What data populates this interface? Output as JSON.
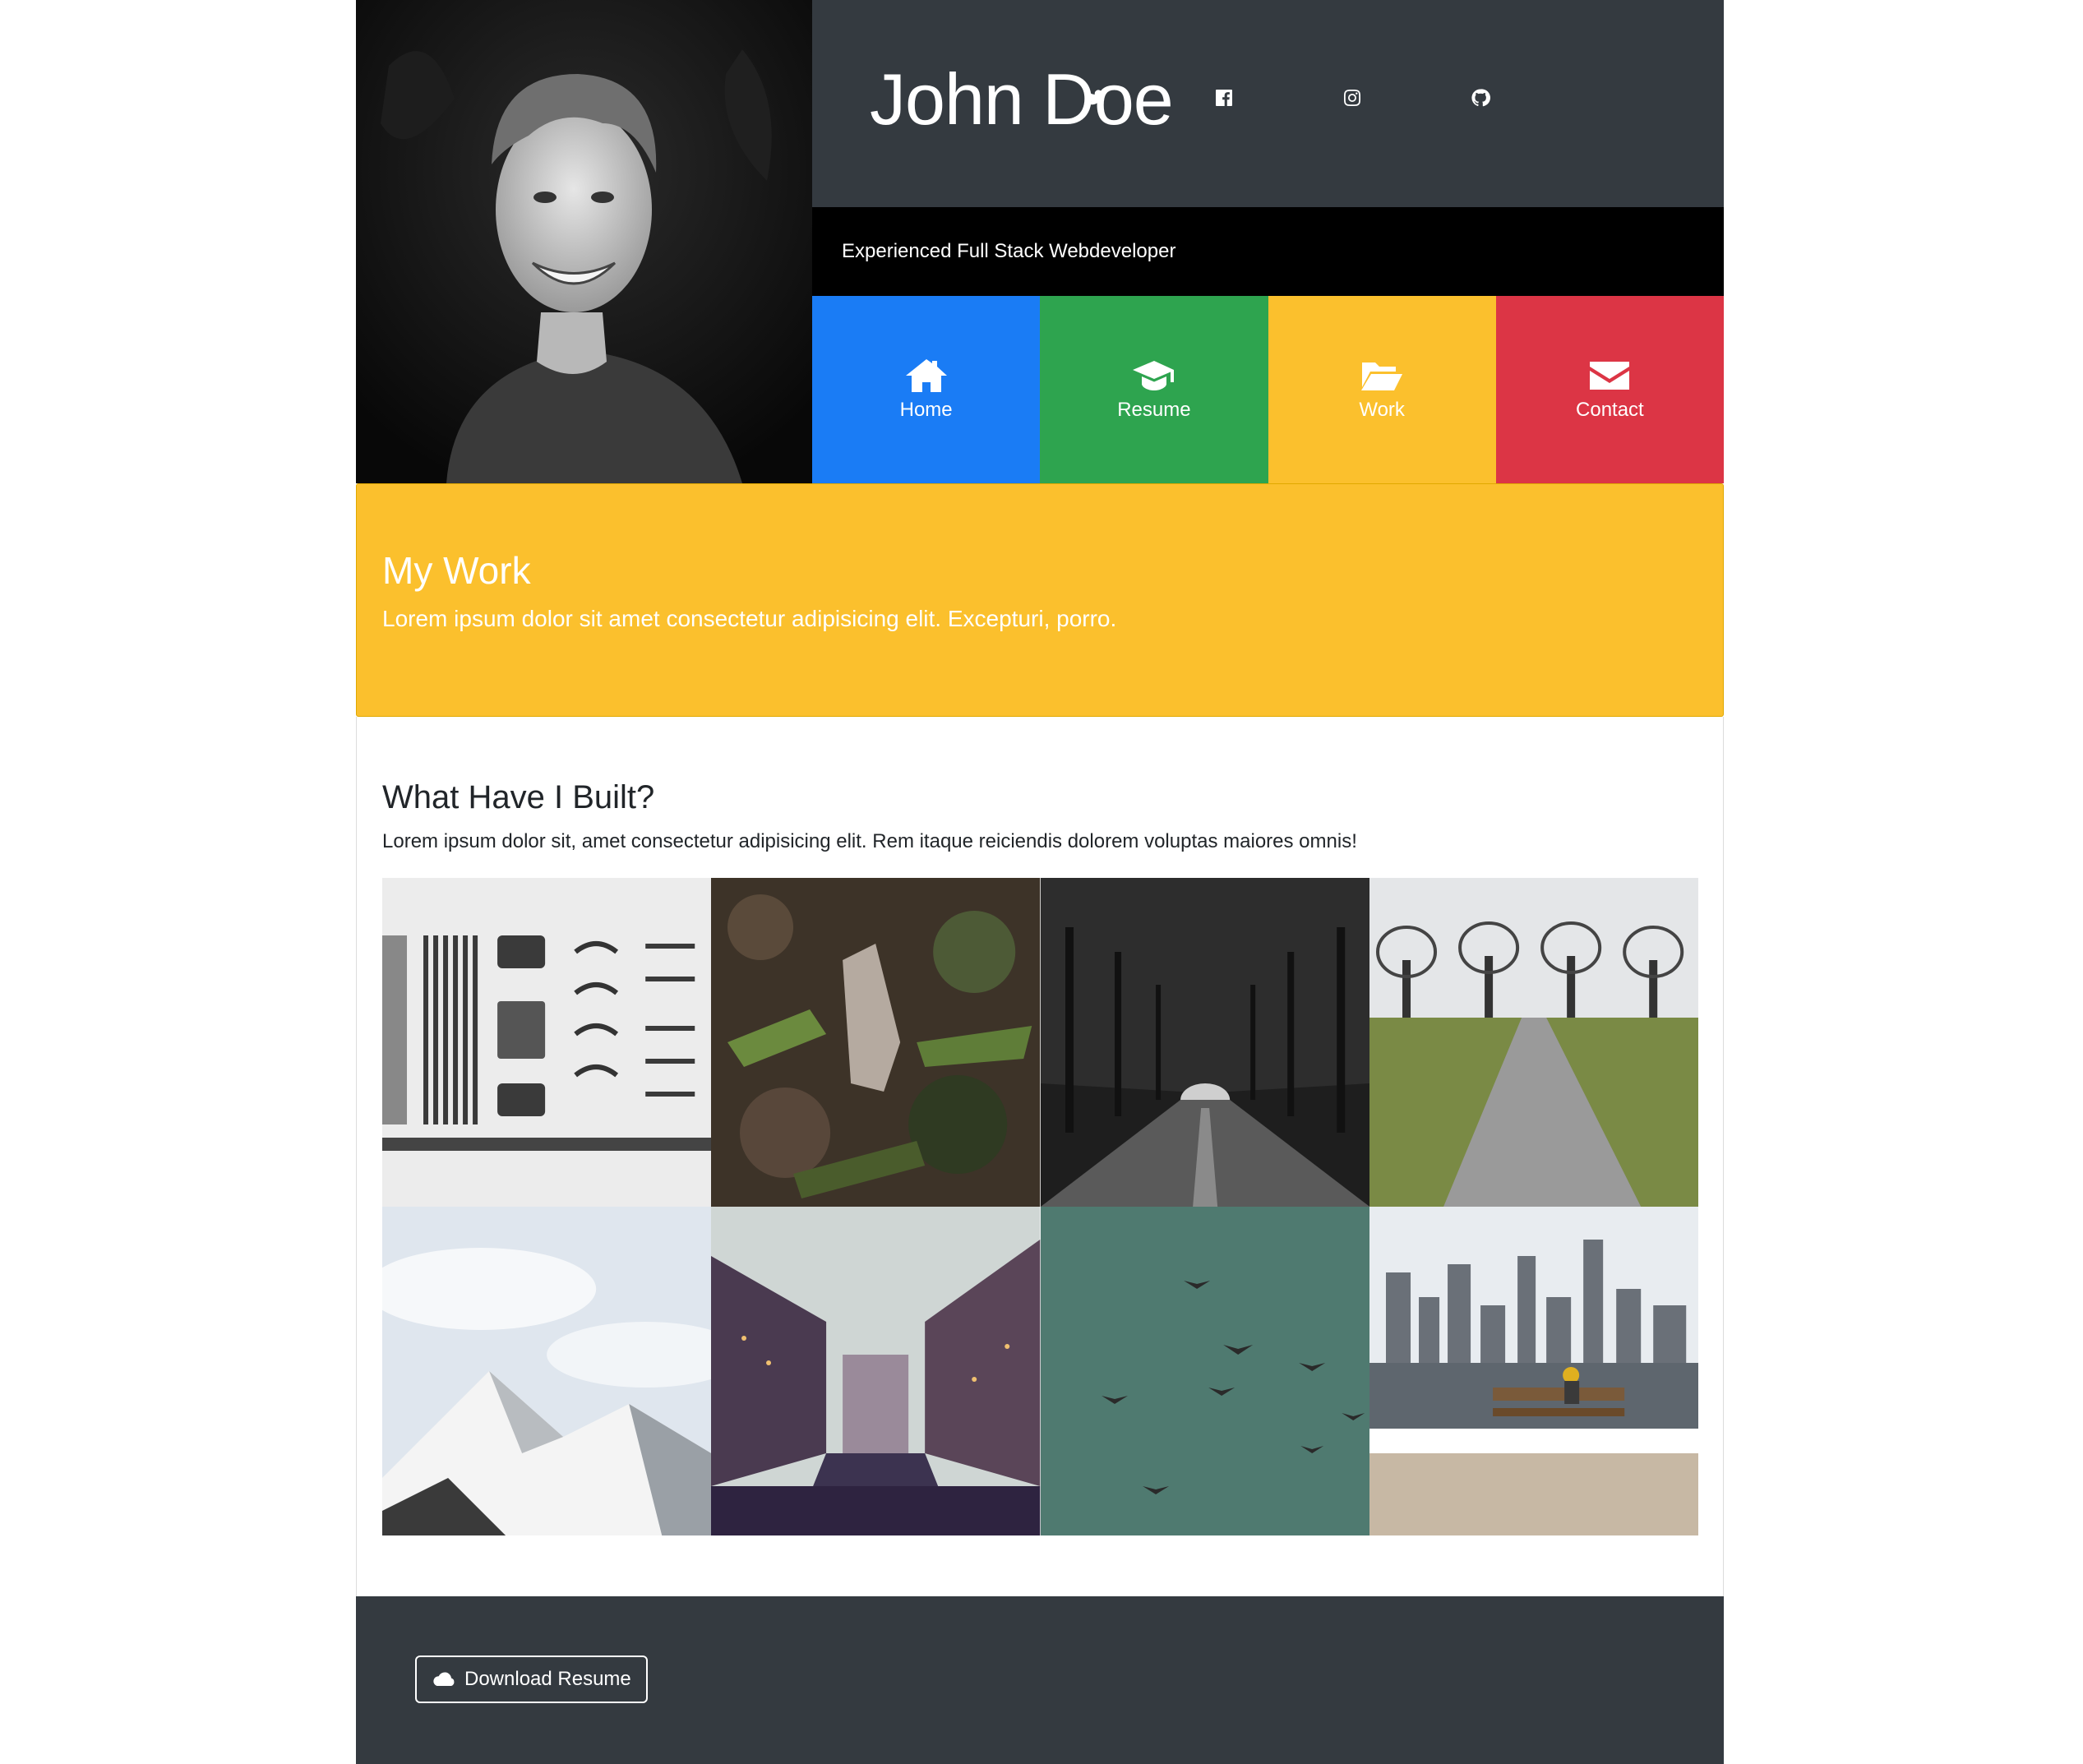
{
  "header": {
    "name": "John Doe",
    "tagline": "Experienced Full Stack Webdeveloper",
    "social": [
      "twitter-icon",
      "facebook-icon",
      "instagram-icon",
      "github-icon"
    ]
  },
  "nav": {
    "items": [
      {
        "label": "Home",
        "icon": "home-icon",
        "color": "#1a7cf5"
      },
      {
        "label": "Resume",
        "icon": "graduation-cap-icon",
        "color": "#2ea44f"
      },
      {
        "label": "Work",
        "icon": "folder-open-icon",
        "color": "#fbc02d"
      },
      {
        "label": "Contact",
        "icon": "envelope-icon",
        "color": "#dc3545"
      }
    ]
  },
  "banner": {
    "title": "My Work",
    "subtitle": "Lorem ipsum dolor sit amet consectetur adipisicing elit. Excepturi, porro."
  },
  "content": {
    "title": "What Have I Built?",
    "text": "Lorem ipsum dolor sit, amet consectetur adipisicing elit. Rem itaque reiciendis dolorem voluptas maiores omnis!"
  },
  "footer": {
    "download_label": "Download Resume",
    "download_icon": "cloud-icon"
  },
  "colors": {
    "dark": "#343a40",
    "black": "#000000",
    "accent_yellow": "#fbc02d"
  }
}
